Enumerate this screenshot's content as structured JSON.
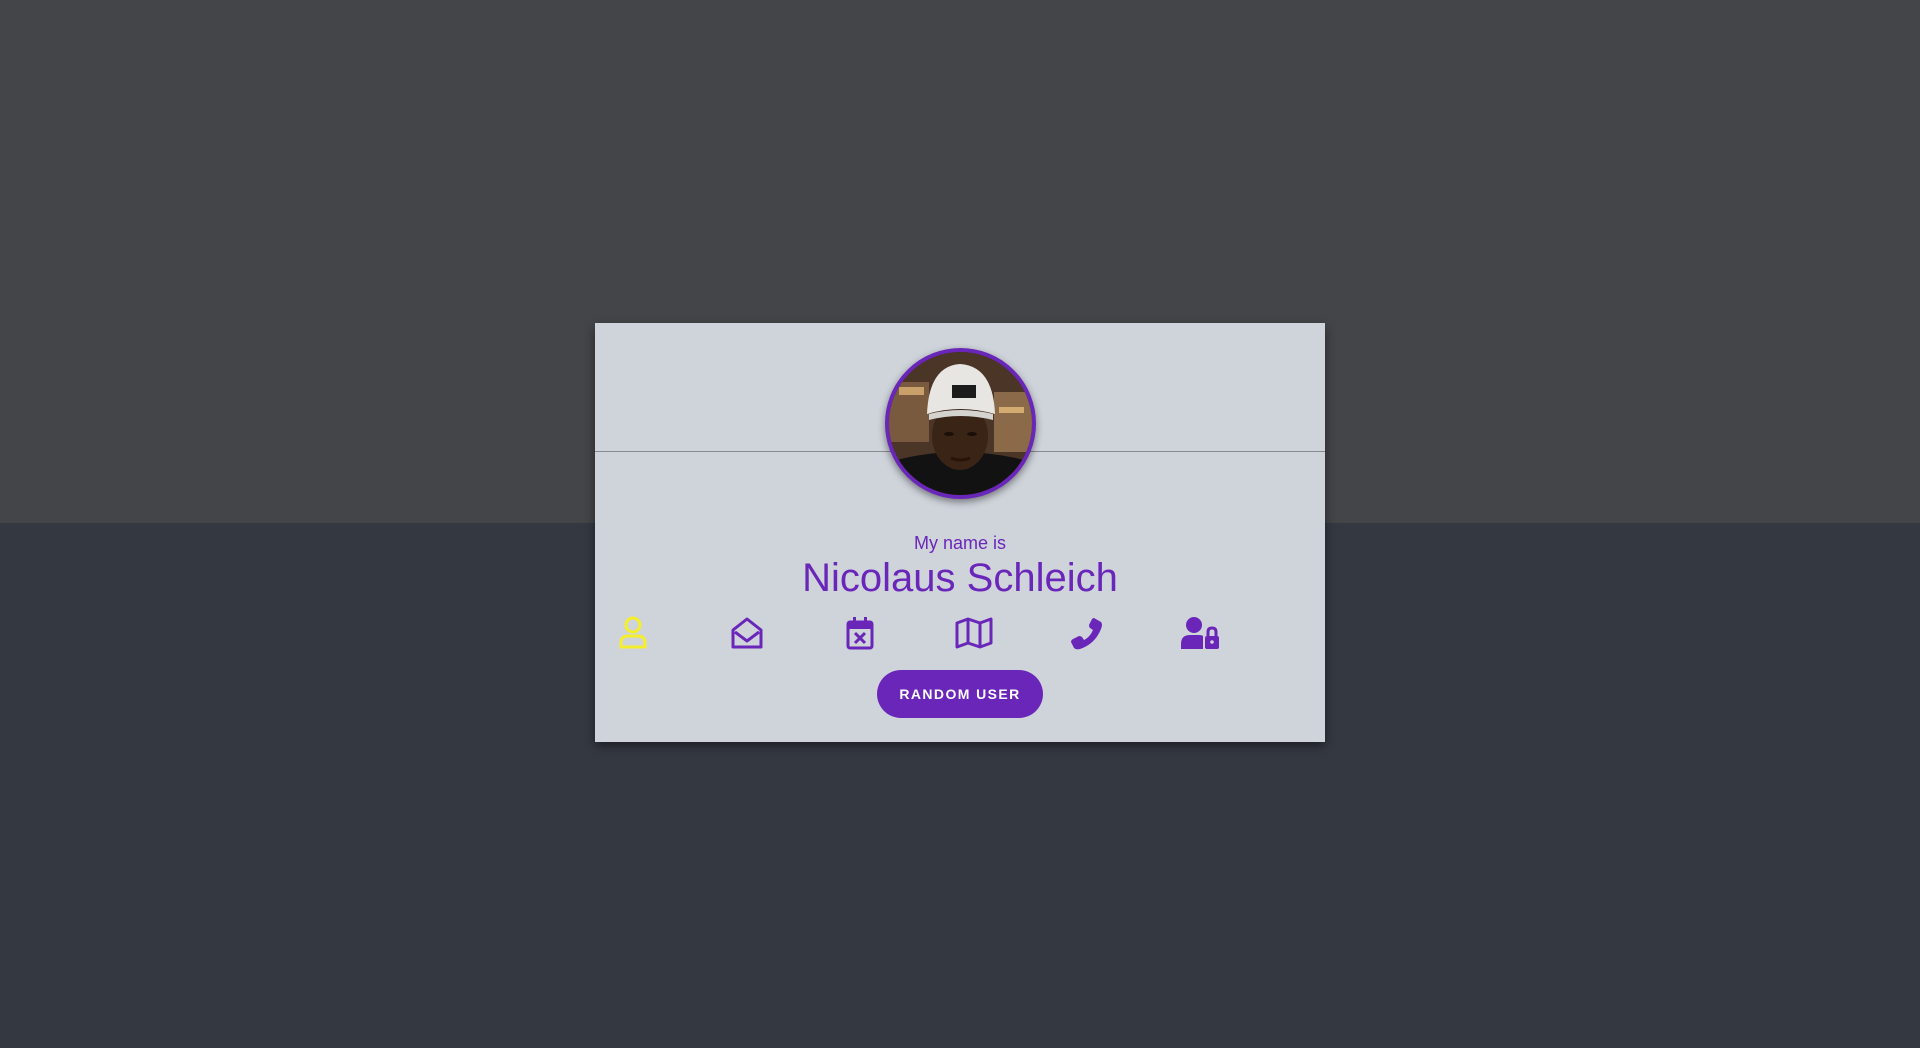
{
  "card": {
    "label": "My name is",
    "value": "Nicolaus Schleich"
  },
  "icons": [
    {
      "name": "user-icon",
      "active": true
    },
    {
      "name": "envelope-open-icon",
      "active": false
    },
    {
      "name": "calendar-x-icon",
      "active": false
    },
    {
      "name": "map-icon",
      "active": false
    },
    {
      "name": "phone-icon",
      "active": false
    },
    {
      "name": "user-lock-icon",
      "active": false
    }
  ],
  "button": {
    "label": "RANDOM USER"
  },
  "colors": {
    "accent": "#6a26b9",
    "active_icon": "#f5ee2b",
    "card_background": "#cfd4db",
    "top_background": "#444548",
    "bottom_background": "#343841"
  }
}
